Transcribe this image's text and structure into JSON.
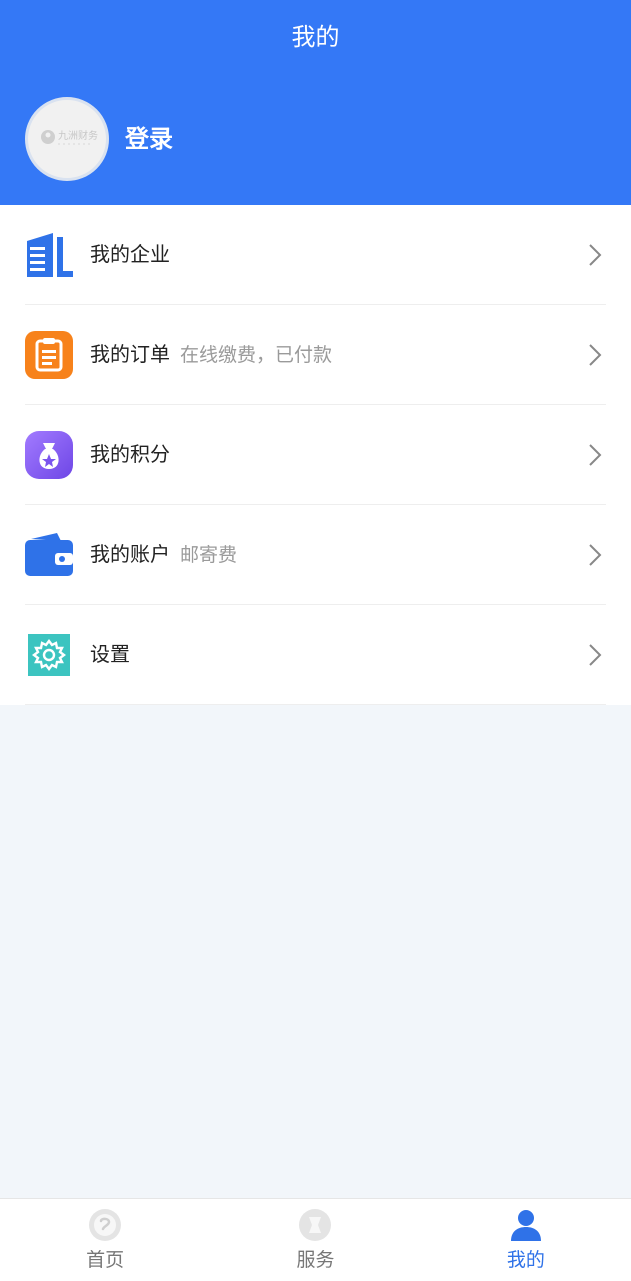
{
  "header": {
    "title": "我的",
    "login_label": "登录",
    "avatar_text": "九洲财务"
  },
  "menu": {
    "items": [
      {
        "label": "我的企业",
        "sub": "",
        "icon": "building-icon",
        "color": "#2f72e8"
      },
      {
        "label": "我的订单",
        "sub": "在线缴费，已付款",
        "icon": "clipboard-icon",
        "color": "#f7821b"
      },
      {
        "label": "我的积分",
        "sub": "",
        "icon": "money-bag-icon",
        "color": "#8b5cf6"
      },
      {
        "label": "我的账户",
        "sub": "邮寄费",
        "icon": "wallet-icon",
        "color": "#2f72e8"
      },
      {
        "label": "设置",
        "sub": "",
        "icon": "gear-icon",
        "color": "#3cc4c0"
      }
    ]
  },
  "tabbar": {
    "tabs": [
      {
        "label": "首页",
        "icon": "home-icon",
        "active": false
      },
      {
        "label": "服务",
        "icon": "service-icon",
        "active": false
      },
      {
        "label": "我的",
        "icon": "person-icon",
        "active": true
      }
    ]
  },
  "colors": {
    "primary": "#3478f6",
    "background": "#f2f6fa",
    "active_tab": "#2f72e8"
  }
}
